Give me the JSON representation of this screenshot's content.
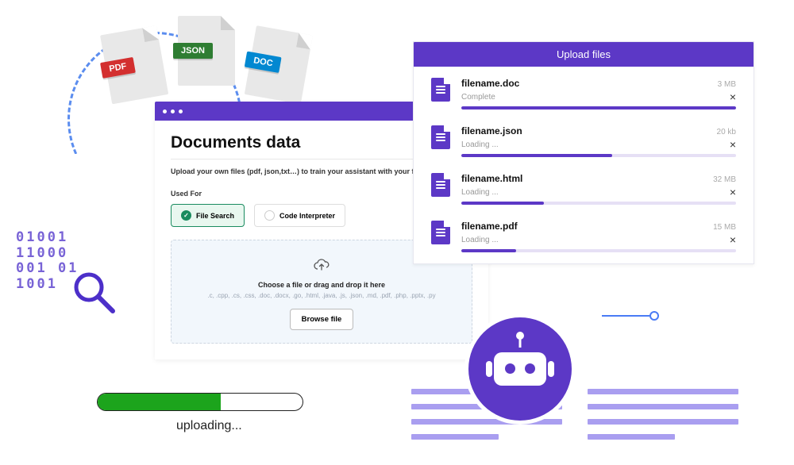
{
  "file_badges": {
    "pdf": "PDF",
    "json": "JSON",
    "doc": "DOC"
  },
  "binary_decor": "01001\n11000\n001 01\n1001",
  "doc_card": {
    "title": "Documents data",
    "subtitle": "Upload your own files (pdf, json,txt…) to train your assistant with your files.",
    "used_for_label": "Used For",
    "options": {
      "file_search": "File Search",
      "code_interpreter": "Code Interpreter"
    },
    "dropzone": {
      "title": "Choose a file or drag and drop it here",
      "extensions": ".c, .cpp, .cs, .css, .doc, .docx, .go, .html, .java, .js, .json, .md, .pdf, .php, .pptx, .py",
      "browse_label": "Browse file"
    }
  },
  "upload_panel": {
    "title": "Upload files",
    "files": [
      {
        "name": "filename.doc",
        "status": "Complete",
        "size": "3 MB",
        "progress": 100
      },
      {
        "name": "filename.json",
        "status": "Loading ...",
        "size": "20 kb",
        "progress": 55
      },
      {
        "name": "filename.html",
        "status": "Loading ...",
        "size": "32 MB",
        "progress": 30
      },
      {
        "name": "filename.pdf",
        "status": "Loading ...",
        "size": "15 MB",
        "progress": 20
      }
    ]
  },
  "big_progress": {
    "percent": 60,
    "label": "uploading..."
  }
}
